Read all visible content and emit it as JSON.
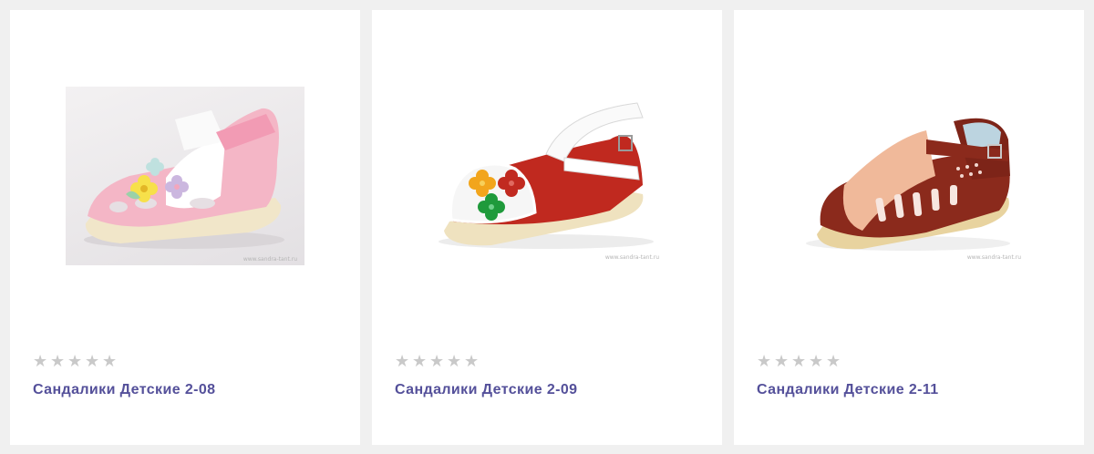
{
  "colors": {
    "page_background": "#f0f0f0",
    "card_background": "#ffffff",
    "title_color": "#54509a",
    "star_empty": "#c9c9c9"
  },
  "products": [
    {
      "name": "Сандалики Детские 2-08",
      "rating": 0,
      "rating_max": 5,
      "image": "pink-sandal-with-flowers",
      "watermark": "www.sandra-tant.ru"
    },
    {
      "name": "Сандалики Детские 2-09",
      "rating": 0,
      "rating_max": 5,
      "image": "red-white-sandal-with-flowers",
      "watermark": "www.sandra-tant.ru"
    },
    {
      "name": "Сандалики Детские 2-11",
      "rating": 0,
      "rating_max": 5,
      "image": "brown-beige-sandal",
      "watermark": "www.sandra-tant.ru"
    }
  ],
  "icons": {
    "star": "star-icon"
  }
}
